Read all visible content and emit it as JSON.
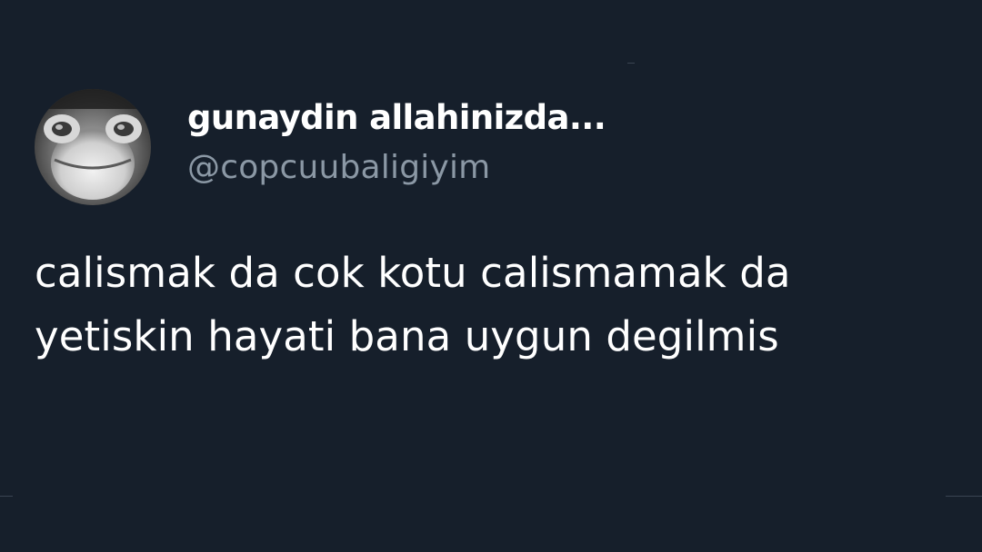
{
  "user": {
    "display_name": "gunaydin allahinizda...",
    "handle": "@copcuubaligiyim",
    "avatar_icon": "frog-face-avatar"
  },
  "tweet": {
    "lines": [
      "calismak da cok kotu calismamak da",
      "yetiskin hayati bana uygun degilmis"
    ]
  },
  "colors": {
    "background": "#161f2b",
    "text_primary": "#ffffff",
    "text_secondary": "#8b98a5"
  }
}
